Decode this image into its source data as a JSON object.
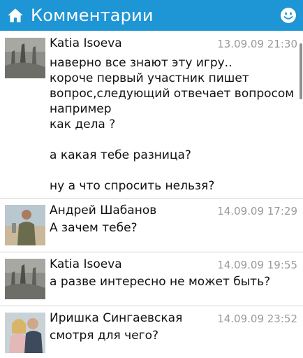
{
  "header": {
    "title": "Комментарии",
    "home_icon": "home-icon",
    "smiley_icon": "smiley-icon",
    "bar_color": "#1e95d4"
  },
  "comments": [
    {
      "author": "Katia Isoeva",
      "time": "13.09.09 21:30",
      "text": "наверно все знают эту игру..\nкороче первый участник пишет\nвопрос,следующий отвечает вопросом\nнапример\nкак дела ?\n\nа какая тебе разница?\n\nну а что спросить нельзя?"
    },
    {
      "author": "Андрей Шабанов",
      "time": "14.09.09 17:29",
      "text": "А зачем тебе?"
    },
    {
      "author": "Katia Isoeva",
      "time": "14.09.09 19:55",
      "text": "а разве интересно не может быть?"
    },
    {
      "author": "Иришка Сингаевская",
      "time": "14.09.09 23:52",
      "text": "смотря для чего?"
    }
  ]
}
